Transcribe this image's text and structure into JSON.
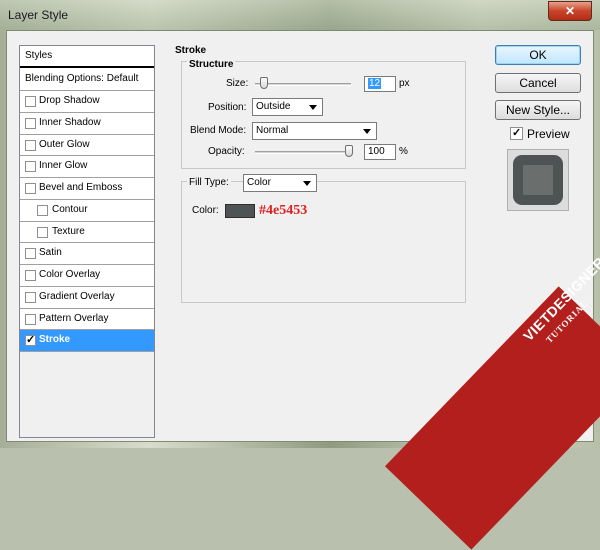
{
  "window": {
    "title": "Layer Style",
    "close_glyph": "✕"
  },
  "styles_list": {
    "header": "Styles",
    "blending": "Blending Options: Default",
    "items": [
      {
        "label": "Drop Shadow",
        "checked": false,
        "indent": false
      },
      {
        "label": "Inner Shadow",
        "checked": false,
        "indent": false
      },
      {
        "label": "Outer Glow",
        "checked": false,
        "indent": false
      },
      {
        "label": "Inner Glow",
        "checked": false,
        "indent": false
      },
      {
        "label": "Bevel and Emboss",
        "checked": false,
        "indent": false
      },
      {
        "label": "Contour",
        "checked": false,
        "indent": true
      },
      {
        "label": "Texture",
        "checked": false,
        "indent": true
      },
      {
        "label": "Satin",
        "checked": false,
        "indent": false
      },
      {
        "label": "Color Overlay",
        "checked": false,
        "indent": false
      },
      {
        "label": "Gradient Overlay",
        "checked": false,
        "indent": false
      },
      {
        "label": "Pattern Overlay",
        "checked": false,
        "indent": false
      },
      {
        "label": "Stroke",
        "checked": true,
        "indent": false,
        "selected": true
      }
    ]
  },
  "stroke": {
    "title": "Stroke",
    "structure_title": "Structure",
    "size_label": "Size:",
    "size_value": "12",
    "size_unit": "px",
    "size_fraction": 0.05,
    "position_label": "Position:",
    "position_value": "Outside",
    "blend_label": "Blend Mode:",
    "blend_value": "Normal",
    "opacity_label": "Opacity:",
    "opacity_value": "100",
    "opacity_unit": "%",
    "opacity_fraction": 1.0,
    "filltype_label": "Fill Type:",
    "filltype_value": "Color",
    "color_label": "Color:",
    "color_hex_text": "#4e5453",
    "color": "#4e5453"
  },
  "buttons": {
    "ok": "OK",
    "cancel": "Cancel",
    "new_style": "New Style..."
  },
  "preview": {
    "label": "Preview",
    "checked": true
  },
  "watermark": {
    "main": "VIETDESIGNER.NET",
    "sub": "TUTORIAL"
  }
}
